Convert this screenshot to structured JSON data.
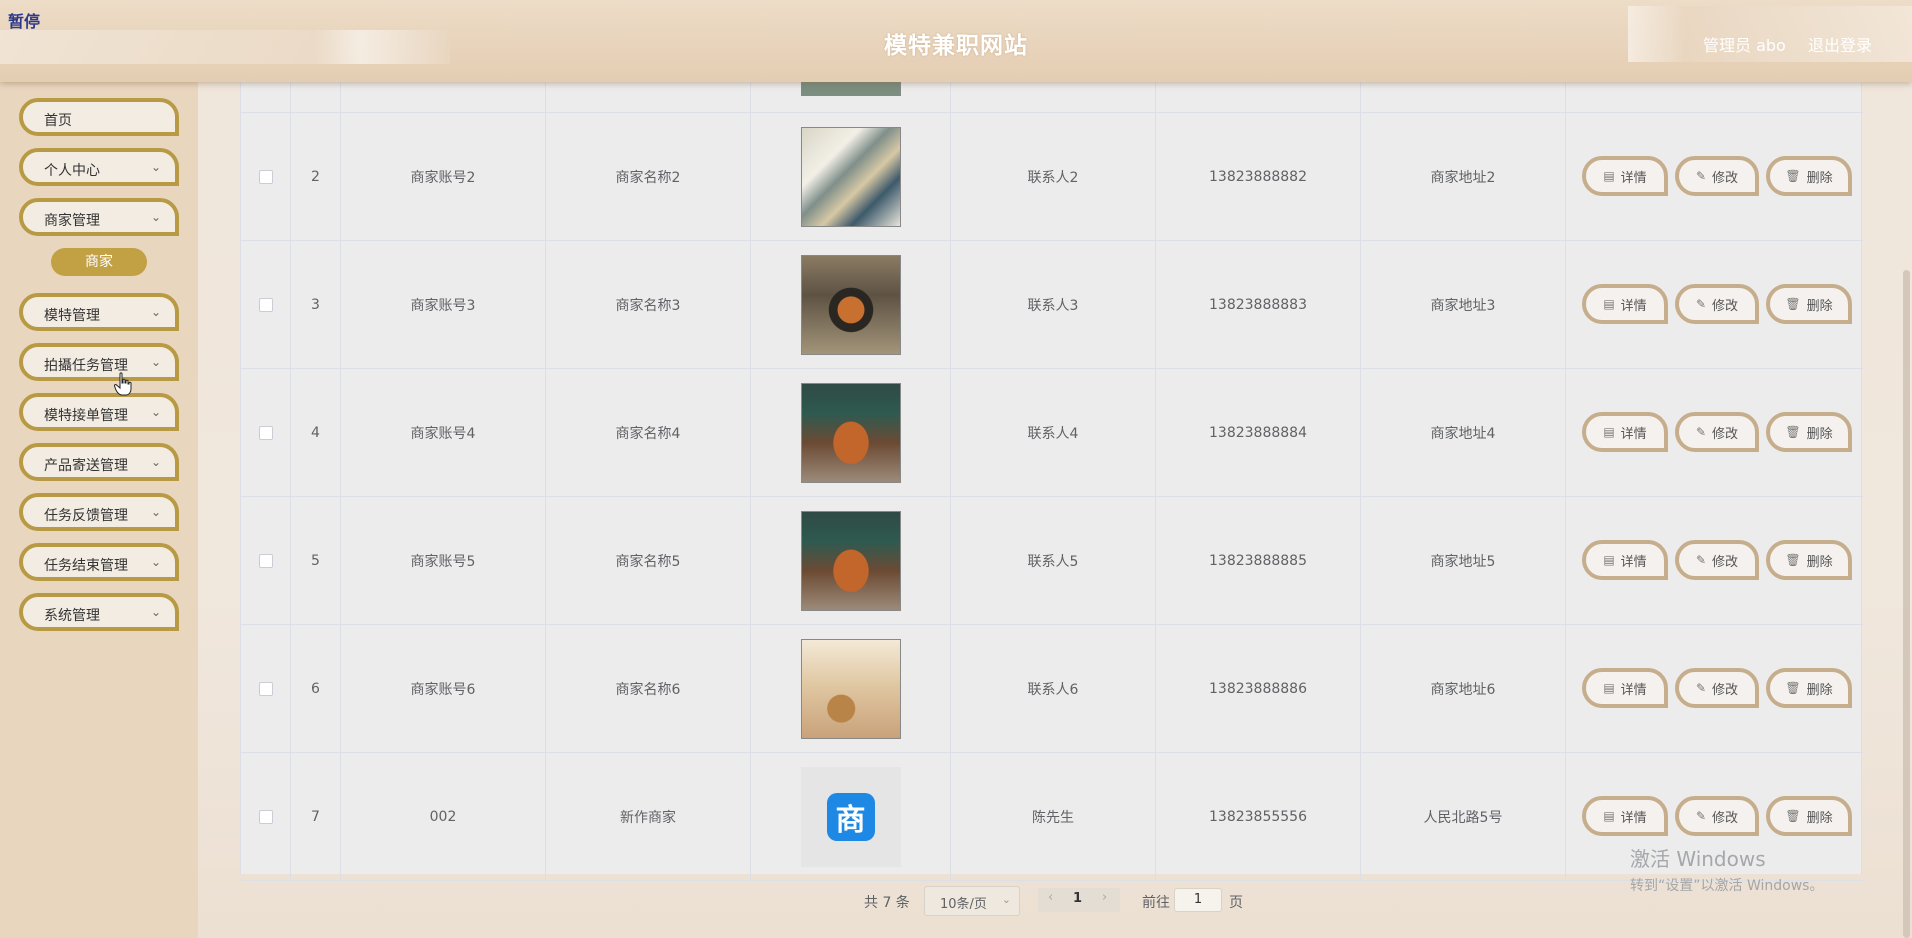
{
  "header": {
    "pause_label": "暂停",
    "title": "模特兼职网站",
    "user": "管理员 abo",
    "logout": "退出登录"
  },
  "sidebar": {
    "items": [
      {
        "label": "首页"
      },
      {
        "label": "个人中心"
      },
      {
        "label": "商家管理"
      },
      {
        "label": "模特管理"
      },
      {
        "label": "拍攝任务管理"
      },
      {
        "label": "模特接单管理"
      },
      {
        "label": "产品寄送管理"
      },
      {
        "label": "任务反馈管理"
      },
      {
        "label": "任务结束管理"
      },
      {
        "label": "系统管理"
      }
    ],
    "active_sub": "商家"
  },
  "table": {
    "rows": [
      {
        "index": "2",
        "account": "商家账号2",
        "name": "商家名称2",
        "contact": "联系人2",
        "phone": "13823888882",
        "address": "商家地址2",
        "image": "supermarket"
      },
      {
        "index": "3",
        "account": "商家账号3",
        "name": "商家名称3",
        "contact": "联系人3",
        "phone": "13823888883",
        "address": "商家地址3",
        "image": "storefront"
      },
      {
        "index": "4",
        "account": "商家账号4",
        "name": "商家名称4",
        "contact": "联系人4",
        "phone": "13823888884",
        "address": "商家地址4",
        "image": "shop-green"
      },
      {
        "index": "5",
        "account": "商家账号5",
        "name": "商家名称5",
        "contact": "联系人5",
        "phone": "13823888885",
        "address": "商家地址5",
        "image": "shop-green"
      },
      {
        "index": "6",
        "account": "商家账号6",
        "name": "商家名称6",
        "contact": "联系人6",
        "phone": "13823888886",
        "address": "商家地址6",
        "image": "gift-shop"
      },
      {
        "index": "7",
        "account": "002",
        "name": "新作商家",
        "contact": "陈先生",
        "phone": "13823855556",
        "address": "人民北路5号",
        "image": "shop-logo",
        "logo_text": "商"
      }
    ],
    "actions": {
      "detail": "详情",
      "edit": "修改",
      "delete": "删除"
    }
  },
  "pagination": {
    "total": "共 7 条",
    "page_size": "10条/页",
    "current_page": "1",
    "goto_prefix": "前往",
    "goto_value": "1",
    "goto_suffix": "页"
  },
  "watermark": {
    "line1": "激活 Windows",
    "line2": "转到“设置”以激活 Windows。"
  }
}
